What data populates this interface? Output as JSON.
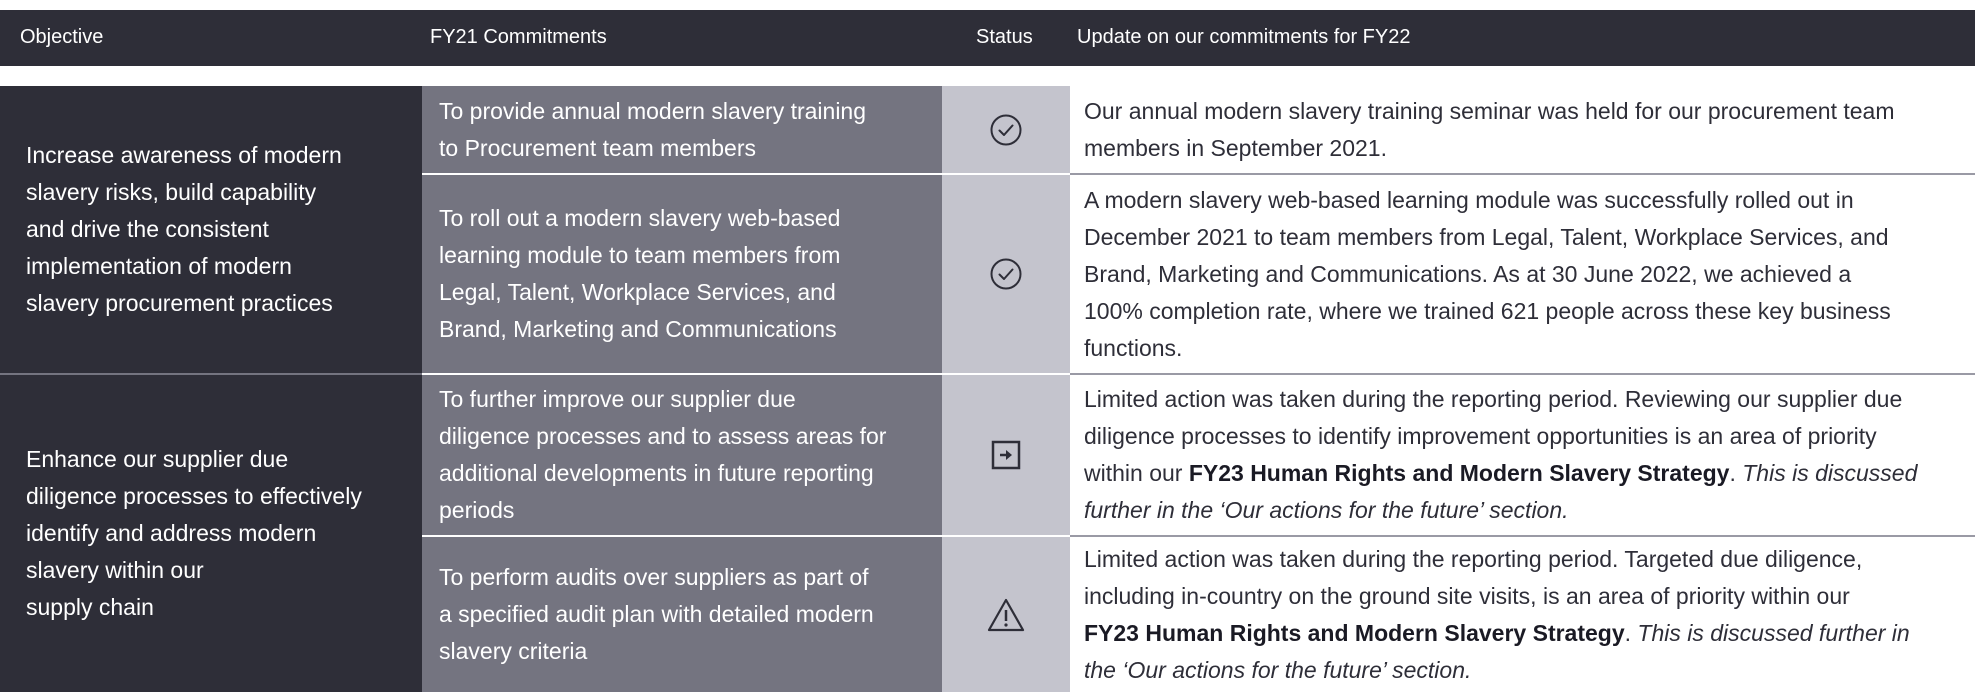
{
  "header": {
    "objective": "Objective",
    "commitments": "FY21 Commitments",
    "status": "Status",
    "update": "Update on our commitments for FY22"
  },
  "objectives": [
    {
      "lines": [
        "Increase awareness of modern",
        "slavery risks, build capability",
        "and drive the consistent",
        "implementation of modern",
        "slavery procurement practices"
      ]
    },
    {
      "lines": [
        "Enhance our supplier due",
        "diligence processes to effectively",
        "identify and address modern",
        "slavery within our",
        "supply chain"
      ]
    }
  ],
  "commitments": [
    {
      "lines": [
        "To provide annual modern slavery training",
        "to Procurement team members"
      ],
      "status_icon": "check-circle-icon",
      "update": [
        [
          {
            "t": "Our annual modern slavery training seminar was held for our procurement team"
          }
        ],
        [
          {
            "t": "members in September 2021."
          }
        ]
      ]
    },
    {
      "lines": [
        "To roll out a modern slavery web-based",
        "learning module to team members from",
        "Legal, Talent, Workplace Services, and",
        "Brand, Marketing and Communications"
      ],
      "status_icon": "check-circle-icon",
      "update": [
        [
          {
            "t": "A modern slavery web-based learning module was successfully rolled out in"
          }
        ],
        [
          {
            "t": "December 2021 to team members from Legal, Talent, Workplace Services, and"
          }
        ],
        [
          {
            "t": "Brand, Marketing and Communications. As at 30 June 2022, we achieved a"
          }
        ],
        [
          {
            "t": "100% completion rate, where we trained 621 people across these key business"
          }
        ],
        [
          {
            "t": "functions."
          }
        ]
      ]
    },
    {
      "lines": [
        "To further improve our supplier due",
        "diligence processes and to assess areas for",
        "additional developments in future reporting",
        "periods"
      ],
      "status_icon": "arrow-box-icon",
      "update": [
        [
          {
            "t": "Limited action was taken during the reporting period. Reviewing our supplier due"
          }
        ],
        [
          {
            "t": "diligence processes to identify improvement opportunities is an area of priority"
          }
        ],
        [
          {
            "t": "within our "
          },
          {
            "t": "FY23 Human Rights and Modern Slavery Strategy",
            "s": "strong"
          },
          {
            "t": ". "
          },
          {
            "t": "This is discussed",
            "s": "em"
          }
        ],
        [
          {
            "t": "further in the ‘Our actions for the future’ section.",
            "s": "em"
          }
        ]
      ]
    },
    {
      "lines": [
        "To perform audits over suppliers as part of",
        "a specified audit plan with detailed modern",
        "slavery criteria"
      ],
      "status_icon": "warning-triangle-icon",
      "update": [
        [
          {
            "t": "Limited action was taken during the reporting period. Targeted due diligence,"
          }
        ],
        [
          {
            "t": "including in-country on the ground site visits, is an area of priority within our"
          }
        ],
        [
          {
            "t": "FY23 Human Rights and Modern Slavery Strategy",
            "s": "strong"
          },
          {
            "t": ". "
          },
          {
            "t": "This is discussed further in",
            "s": "em"
          }
        ],
        [
          {
            "t": "the ‘Our actions for the future’ section.",
            "s": "em"
          }
        ]
      ]
    }
  ]
}
